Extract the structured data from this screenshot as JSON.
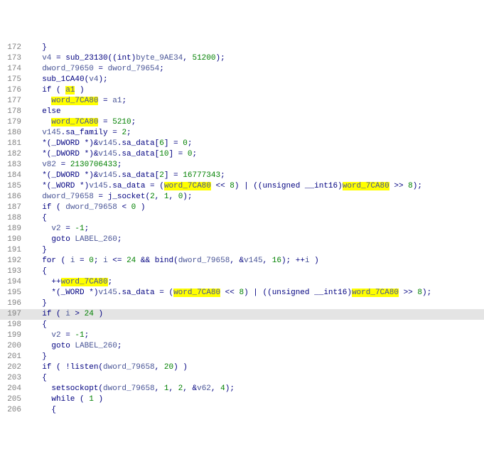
{
  "lines": [
    {
      "n": 172,
      "indent": 1,
      "tokens": [
        {
          "t": "}",
          "c": "op"
        }
      ]
    },
    {
      "n": 173,
      "indent": 1,
      "tokens": [
        {
          "t": "v4",
          "c": "var"
        },
        {
          "t": " = "
        },
        {
          "t": "sub_23130",
          "c": "func"
        },
        {
          "t": "(("
        },
        {
          "t": "int",
          "c": "kw"
        },
        {
          "t": ")"
        },
        {
          "t": "byte_9AE34",
          "c": "var"
        },
        {
          "t": ", "
        },
        {
          "t": "51200",
          "c": "num"
        },
        {
          "t": ");"
        }
      ]
    },
    {
      "n": 174,
      "indent": 1,
      "tokens": [
        {
          "t": "dword_79650",
          "c": "var"
        },
        {
          "t": " = "
        },
        {
          "t": "dword_79654",
          "c": "var"
        },
        {
          "t": ";"
        }
      ]
    },
    {
      "n": 175,
      "indent": 1,
      "tokens": [
        {
          "t": "sub_1CA40",
          "c": "func"
        },
        {
          "t": "("
        },
        {
          "t": "v4",
          "c": "var"
        },
        {
          "t": ");"
        }
      ]
    },
    {
      "n": 176,
      "indent": 1,
      "tokens": [
        {
          "t": "if",
          "c": "kw"
        },
        {
          "t": " ( "
        },
        {
          "t": "a1",
          "c": "var",
          "hl": true
        },
        {
          "t": " )"
        }
      ]
    },
    {
      "n": 177,
      "indent": 2,
      "tokens": [
        {
          "t": "word_7CA80",
          "c": "var",
          "hl": true
        },
        {
          "t": " = "
        },
        {
          "t": "a1",
          "c": "var"
        },
        {
          "t": ";"
        }
      ]
    },
    {
      "n": 178,
      "indent": 1,
      "tokens": [
        {
          "t": "else",
          "c": "kw"
        }
      ]
    },
    {
      "n": 179,
      "indent": 2,
      "tokens": [
        {
          "t": "word_7CA80",
          "c": "var",
          "hl": true
        },
        {
          "t": " = "
        },
        {
          "t": "5210",
          "c": "num"
        },
        {
          "t": ";"
        }
      ]
    },
    {
      "n": 180,
      "indent": 1,
      "tokens": [
        {
          "t": "v145",
          "c": "var"
        },
        {
          "t": ".sa_family = "
        },
        {
          "t": "2",
          "c": "num"
        },
        {
          "t": ";"
        }
      ]
    },
    {
      "n": 181,
      "indent": 1,
      "tokens": [
        {
          "t": "*("
        },
        {
          "t": "_DWORD",
          "c": "kw"
        },
        {
          "t": " *)&"
        },
        {
          "t": "v145",
          "c": "var"
        },
        {
          "t": ".sa_data["
        },
        {
          "t": "6",
          "c": "num"
        },
        {
          "t": "] = "
        },
        {
          "t": "0",
          "c": "num"
        },
        {
          "t": ";"
        }
      ]
    },
    {
      "n": 182,
      "indent": 1,
      "tokens": [
        {
          "t": "*("
        },
        {
          "t": "_DWORD",
          "c": "kw"
        },
        {
          "t": " *)&"
        },
        {
          "t": "v145",
          "c": "var"
        },
        {
          "t": ".sa_data["
        },
        {
          "t": "10",
          "c": "num"
        },
        {
          "t": "] = "
        },
        {
          "t": "0",
          "c": "num"
        },
        {
          "t": ";"
        }
      ]
    },
    {
      "n": 183,
      "indent": 1,
      "tokens": [
        {
          "t": "v82",
          "c": "var"
        },
        {
          "t": " = "
        },
        {
          "t": "2130706433",
          "c": "num"
        },
        {
          "t": ";"
        }
      ]
    },
    {
      "n": 184,
      "indent": 1,
      "tokens": [
        {
          "t": "*("
        },
        {
          "t": "_DWORD",
          "c": "kw"
        },
        {
          "t": " *)&"
        },
        {
          "t": "v145",
          "c": "var"
        },
        {
          "t": ".sa_data["
        },
        {
          "t": "2",
          "c": "num"
        },
        {
          "t": "] = "
        },
        {
          "t": "16777343",
          "c": "num"
        },
        {
          "t": ";"
        }
      ]
    },
    {
      "n": 185,
      "indent": 1,
      "tokens": [
        {
          "t": "*("
        },
        {
          "t": "_WORD",
          "c": "kw"
        },
        {
          "t": " *)"
        },
        {
          "t": "v145",
          "c": "var"
        },
        {
          "t": ".sa_data = ("
        },
        {
          "t": "word_7CA80",
          "c": "var",
          "hl": true
        },
        {
          "t": " << "
        },
        {
          "t": "8",
          "c": "num"
        },
        {
          "t": ") | (("
        },
        {
          "t": "unsigned",
          "c": "kw"
        },
        {
          "t": " "
        },
        {
          "t": "__int16",
          "c": "kw"
        },
        {
          "t": ")"
        },
        {
          "t": "word_7CA80",
          "c": "var",
          "hl": true
        },
        {
          "t": " >> "
        },
        {
          "t": "8",
          "c": "num"
        },
        {
          "t": ");"
        }
      ]
    },
    {
      "n": 186,
      "indent": 1,
      "tokens": [
        {
          "t": "dword_79658",
          "c": "var"
        },
        {
          "t": " = "
        },
        {
          "t": "j_socket",
          "c": "func"
        },
        {
          "t": "("
        },
        {
          "t": "2",
          "c": "num"
        },
        {
          "t": ", "
        },
        {
          "t": "1",
          "c": "num"
        },
        {
          "t": ", "
        },
        {
          "t": "0",
          "c": "num"
        },
        {
          "t": ");"
        }
      ]
    },
    {
      "n": 187,
      "indent": 1,
      "tokens": [
        {
          "t": "if",
          "c": "kw"
        },
        {
          "t": " ( "
        },
        {
          "t": "dword_79658",
          "c": "var"
        },
        {
          "t": " < "
        },
        {
          "t": "0",
          "c": "num"
        },
        {
          "t": " )"
        }
      ]
    },
    {
      "n": 188,
      "indent": 1,
      "tokens": [
        {
          "t": "{",
          "c": "op"
        }
      ]
    },
    {
      "n": 189,
      "indent": 2,
      "tokens": [
        {
          "t": "v2",
          "c": "var"
        },
        {
          "t": " = "
        },
        {
          "t": "-1",
          "c": "num"
        },
        {
          "t": ";"
        }
      ]
    },
    {
      "n": 190,
      "indent": 2,
      "tokens": [
        {
          "t": "goto",
          "c": "kw"
        },
        {
          "t": " "
        },
        {
          "t": "LABEL_260",
          "c": "var"
        },
        {
          "t": ";"
        }
      ]
    },
    {
      "n": 191,
      "indent": 1,
      "tokens": [
        {
          "t": "}",
          "c": "op"
        }
      ]
    },
    {
      "n": 192,
      "indent": 1,
      "tokens": [
        {
          "t": "for",
          "c": "kw"
        },
        {
          "t": " ( "
        },
        {
          "t": "i",
          "c": "var"
        },
        {
          "t": " = "
        },
        {
          "t": "0",
          "c": "num"
        },
        {
          "t": "; "
        },
        {
          "t": "i",
          "c": "var"
        },
        {
          "t": " <= "
        },
        {
          "t": "24",
          "c": "num"
        },
        {
          "t": " && "
        },
        {
          "t": "bind",
          "c": "func"
        },
        {
          "t": "("
        },
        {
          "t": "dword_79658",
          "c": "var"
        },
        {
          "t": ", &"
        },
        {
          "t": "v145",
          "c": "var"
        },
        {
          "t": ", "
        },
        {
          "t": "16",
          "c": "num"
        },
        {
          "t": "); ++"
        },
        {
          "t": "i",
          "c": "var"
        },
        {
          "t": " )"
        }
      ]
    },
    {
      "n": 193,
      "indent": 1,
      "tokens": [
        {
          "t": "{",
          "c": "op"
        }
      ]
    },
    {
      "n": 194,
      "indent": 2,
      "tokens": [
        {
          "t": "++"
        },
        {
          "t": "word_7CA80",
          "c": "var",
          "hl": true
        },
        {
          "t": ";"
        }
      ]
    },
    {
      "n": 195,
      "indent": 2,
      "tokens": [
        {
          "t": "*("
        },
        {
          "t": "_WORD",
          "c": "kw"
        },
        {
          "t": " *)"
        },
        {
          "t": "v145",
          "c": "var"
        },
        {
          "t": ".sa_data = ("
        },
        {
          "t": "word_7CA80",
          "c": "var",
          "hl": true
        },
        {
          "t": " << "
        },
        {
          "t": "8",
          "c": "num"
        },
        {
          "t": ") | (("
        },
        {
          "t": "unsigned",
          "c": "kw"
        },
        {
          "t": " "
        },
        {
          "t": "__int16",
          "c": "kw"
        },
        {
          "t": ")"
        },
        {
          "t": "word_7CA80",
          "c": "var",
          "hl": true
        },
        {
          "t": " >> "
        },
        {
          "t": "8",
          "c": "num"
        },
        {
          "t": ");"
        }
      ]
    },
    {
      "n": 196,
      "indent": 1,
      "tokens": [
        {
          "t": "}",
          "c": "op"
        }
      ]
    },
    {
      "n": 197,
      "indent": 1,
      "current": true,
      "tokens": [
        {
          "t": "if",
          "c": "kw"
        },
        {
          "t": " ( "
        },
        {
          "t": "i",
          "c": "var"
        },
        {
          "t": " > "
        },
        {
          "t": "24",
          "c": "num"
        },
        {
          "t": " )"
        }
      ]
    },
    {
      "n": 198,
      "indent": 1,
      "tokens": [
        {
          "t": "{",
          "c": "op"
        }
      ]
    },
    {
      "n": 199,
      "indent": 2,
      "tokens": [
        {
          "t": "v2",
          "c": "var"
        },
        {
          "t": " = "
        },
        {
          "t": "-1",
          "c": "num"
        },
        {
          "t": ";"
        }
      ]
    },
    {
      "n": 200,
      "indent": 2,
      "tokens": [
        {
          "t": "goto",
          "c": "kw"
        },
        {
          "t": " "
        },
        {
          "t": "LABEL_260",
          "c": "var"
        },
        {
          "t": ";"
        }
      ]
    },
    {
      "n": 201,
      "indent": 1,
      "tokens": [
        {
          "t": "}",
          "c": "op"
        }
      ]
    },
    {
      "n": 202,
      "indent": 1,
      "tokens": [
        {
          "t": "if",
          "c": "kw"
        },
        {
          "t": " ( !"
        },
        {
          "t": "listen",
          "c": "func"
        },
        {
          "t": "("
        },
        {
          "t": "dword_79658",
          "c": "var"
        },
        {
          "t": ", "
        },
        {
          "t": "20",
          "c": "num"
        },
        {
          "t": ") )"
        }
      ]
    },
    {
      "n": 203,
      "indent": 1,
      "tokens": [
        {
          "t": "{",
          "c": "op"
        }
      ]
    },
    {
      "n": 204,
      "indent": 2,
      "tokens": [
        {
          "t": "setsockopt",
          "c": "func"
        },
        {
          "t": "("
        },
        {
          "t": "dword_79658",
          "c": "var"
        },
        {
          "t": ", "
        },
        {
          "t": "1",
          "c": "num"
        },
        {
          "t": ", "
        },
        {
          "t": "2",
          "c": "num"
        },
        {
          "t": ", &"
        },
        {
          "t": "v62",
          "c": "var"
        },
        {
          "t": ", "
        },
        {
          "t": "4",
          "c": "num"
        },
        {
          "t": ");"
        }
      ]
    },
    {
      "n": 205,
      "indent": 2,
      "tokens": [
        {
          "t": "while",
          "c": "kw"
        },
        {
          "t": " ( "
        },
        {
          "t": "1",
          "c": "num"
        },
        {
          "t": " )"
        }
      ]
    },
    {
      "n": 206,
      "indent": 2,
      "tokens": [
        {
          "t": "{",
          "c": "op"
        }
      ]
    }
  ]
}
